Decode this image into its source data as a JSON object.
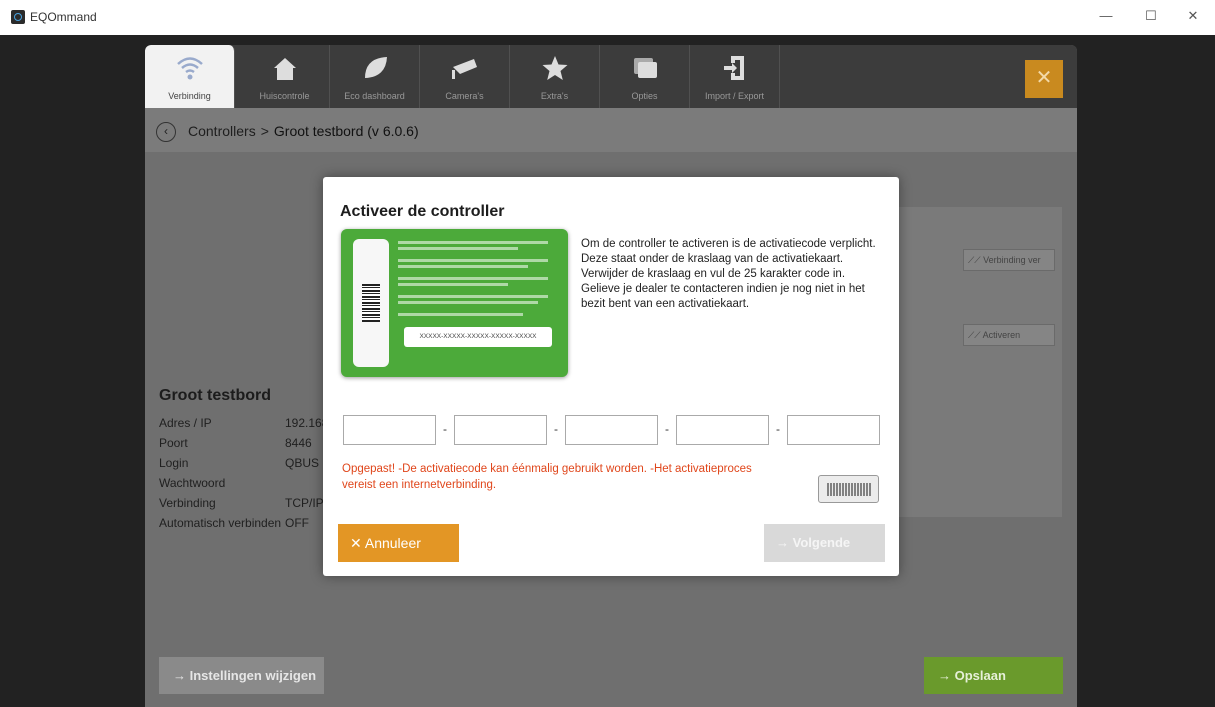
{
  "window": {
    "title": "EQOmmand"
  },
  "tabs": [
    {
      "label": "Verbinding"
    },
    {
      "label": "Huiscontrole"
    },
    {
      "label": "Eco dashboard"
    },
    {
      "label": "Camera's"
    },
    {
      "label": "Extra's"
    },
    {
      "label": "Opties"
    },
    {
      "label": "Import / Export"
    }
  ],
  "breadcrumb": {
    "parent": "Controllers",
    "separator": ">",
    "current": "Groot testbord (v 6.0.6)"
  },
  "controller": {
    "name": "Groot testbord",
    "rows": [
      {
        "label": "Adres / IP",
        "value": "192.168"
      },
      {
        "label": "Poort",
        "value": "8446"
      },
      {
        "label": "Login",
        "value": "QBUS"
      },
      {
        "label": "Wachtwoord",
        "value": ""
      },
      {
        "label": "Verbinding",
        "value": "TCP/IP"
      },
      {
        "label": "Automatisch verbinden",
        "value": "OFF"
      }
    ]
  },
  "side_buttons": {
    "connect": "Verbinding ver",
    "activate": "Activeren"
  },
  "footer": {
    "settings": "Instellingen wijzigen",
    "save": "Opslaan"
  },
  "modal": {
    "title": "Activeer de controller",
    "description": "Om de controller te activeren is de activatiecode verplicht. Deze staat onder de kraslaag van de activatiekaart. Verwijder de kraslaag en vul de 25 karakter code in. Gelieve je dealer te contacteren indien je nog niet in het bezit bent van een activatiekaart.",
    "card_code": "XXXXX-XXXXX-XXXXX-XXXXX-XXXXX",
    "code_fields": [
      "",
      "",
      "",
      "",
      ""
    ],
    "warning": "Opgepast! -De activatiecode kan éénmalig gebruikt worden. -Het activatieproces vereist een internetverbinding.",
    "cancel": "Annuleer",
    "next": "Volgende"
  },
  "colors": {
    "accent_orange": "#e39625",
    "save_green": "#6a9a2c",
    "warning": "#e0461b"
  }
}
